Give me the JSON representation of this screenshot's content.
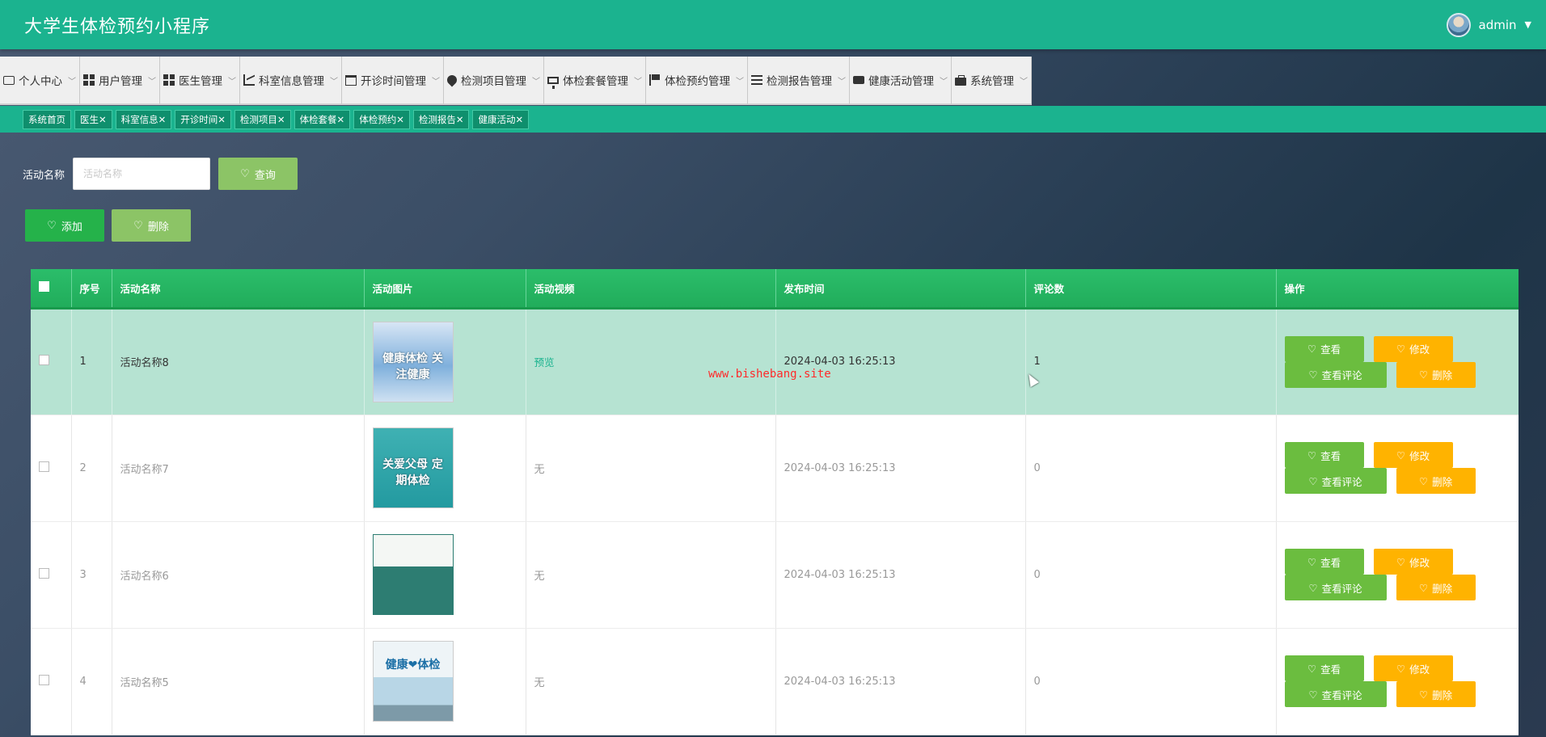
{
  "header": {
    "title": "大学生体检预约小程序",
    "user": "admin"
  },
  "menu": [
    {
      "label": "个人中心",
      "icon": "card-icon"
    },
    {
      "label": "用户管理",
      "icon": "grid-icon"
    },
    {
      "label": "医生管理",
      "icon": "grid-icon"
    },
    {
      "label": "科室信息管理",
      "icon": "chart-icon"
    },
    {
      "label": "开诊时间管理",
      "icon": "calendar-icon"
    },
    {
      "label": "检测项目管理",
      "icon": "pin-icon"
    },
    {
      "label": "体检套餐管理",
      "icon": "monitor-icon"
    },
    {
      "label": "体检预约管理",
      "icon": "flag-icon"
    },
    {
      "label": "检测报告管理",
      "icon": "list-icon"
    },
    {
      "label": "健康活动管理",
      "icon": "chat-icon"
    },
    {
      "label": "系统管理",
      "icon": "briefcase-icon"
    }
  ],
  "tags": [
    "系统首页",
    "医生✕",
    "科室信息✕",
    "开诊时间✕",
    "检测项目✕",
    "体检套餐✕",
    "体检预约✕",
    "检测报告✕",
    "健康活动✕"
  ],
  "search": {
    "label": "活动名称",
    "placeholder": "活动名称",
    "query_button": "查询"
  },
  "actions": {
    "add": "添加",
    "delete": "删除"
  },
  "table": {
    "columns": [
      "序号",
      "活动名称",
      "活动图片",
      "活动视频",
      "发布时间",
      "评论数",
      "操作"
    ],
    "rows": [
      {
        "index": "1",
        "name": "活动名称8",
        "image_text": "健康体检 关注健康",
        "video": "预览",
        "time": "2024-04-03 16:25:13",
        "comments": "1"
      },
      {
        "index": "2",
        "name": "活动名称7",
        "image_text": "关爱父母 定期体检",
        "video": "无",
        "time": "2024-04-03 16:25:13",
        "comments": "0"
      },
      {
        "index": "3",
        "name": "活动名称6",
        "image_text": "",
        "video": "无",
        "time": "2024-04-03 16:25:13",
        "comments": "0"
      },
      {
        "index": "4",
        "name": "活动名称5",
        "image_text": "健康❤体检",
        "video": "无",
        "time": "2024-04-03 16:25:13",
        "comments": "0"
      }
    ],
    "row_actions": {
      "view": "查看",
      "edit": "修改",
      "comments": "查看评论",
      "delete": "删除"
    }
  },
  "watermark": "www.bishebang.site",
  "colors": {
    "brand": "#1bb38f",
    "table_header": "#25b45f",
    "button_green": "#6bbd3f",
    "button_orange": "#ffb300",
    "selected_row": "#b6e3d2"
  }
}
